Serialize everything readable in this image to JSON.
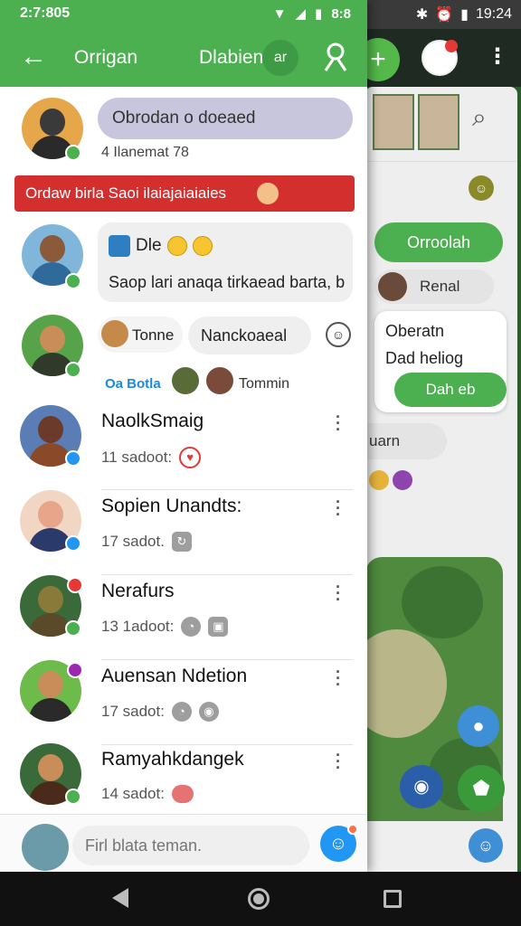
{
  "status_bar": {
    "time": "2:7:805",
    "right_value": "8:8",
    "bg_time": "19:24"
  },
  "app_bar": {
    "title": "Orrigan",
    "title2": "Dlabien",
    "pill": "ar"
  },
  "background_app": {
    "green_pill": "Orroolah",
    "name_pill": "Renal",
    "card_line1": "Oberatn",
    "card_line2": "Dad heliog",
    "card_button": "Dah eb",
    "chip": "uarn"
  },
  "top_chats": {
    "bubble1_text": "Obrodan o doeaed",
    "bubble1_meta": "4 Ilanemat 78",
    "banner_text": "Ordaw birla Saoi ilaiajaiaiaies",
    "bubble2_line1": "Dle",
    "bubble2_line2": "Saop lari anaqa tirkaead barta, b",
    "chip1_text": "Tonne",
    "chip2_text": "Nanckoaeal",
    "sub_label": "Oa Botla",
    "mini_name": "Tommin"
  },
  "chat_list": [
    {
      "name": "NaolkSmaig",
      "time": "11 sadoot:",
      "icon": "heart-icon"
    },
    {
      "name": "Sopien Unandts:",
      "time": "17 sadot.",
      "icon": "refresh-icon"
    },
    {
      "name": "Nerafurs",
      "time": "13 1adoot:",
      "icon": "people-icon"
    },
    {
      "name": "Auensan Ndetion",
      "time": "17 sadot:",
      "icon": "location-icon"
    },
    {
      "name": "Ramyahkdangek",
      "time": "14 sadot:",
      "icon": "hand-icon"
    }
  ],
  "compose": {
    "placeholder": "Firl blata teman."
  },
  "colors": {
    "primary_green": "#4caf50",
    "banner_red": "#d32f2f",
    "accent_blue": "#2196f3"
  }
}
